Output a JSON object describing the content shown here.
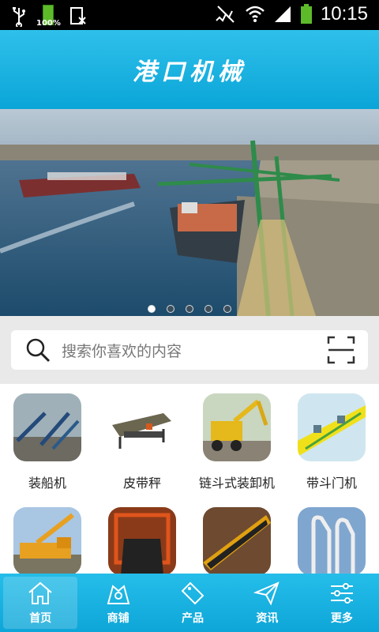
{
  "status_bar": {
    "battery_label": "100%",
    "time": "10:15"
  },
  "header": {
    "title": "港口机械"
  },
  "banner": {
    "slide_count": 5,
    "active_index": 0
  },
  "search": {
    "placeholder": "搜索你喜欢的内容"
  },
  "categories": [
    {
      "label": "装船机",
      "icon": "ship-loader-photo"
    },
    {
      "label": "皮带秤",
      "icon": "belt-scale-photo"
    },
    {
      "label": "链斗式装卸机",
      "icon": "bucket-chain-loader-photo"
    },
    {
      "label": "带斗门机",
      "icon": "hopper-portal-crane-photo"
    },
    {
      "label": "",
      "icon": "mobile-crane-photo"
    },
    {
      "label": "",
      "icon": "conveyor-belt-photo"
    },
    {
      "label": "",
      "icon": "belt-conveyor-photo"
    },
    {
      "label": "",
      "icon": "loading-arms-photo"
    }
  ],
  "tabs": [
    {
      "label": "首页",
      "icon": "home-icon"
    },
    {
      "label": "商铺",
      "icon": "shop-icon"
    },
    {
      "label": "产品",
      "icon": "sale-tag-icon"
    },
    {
      "label": "资讯",
      "icon": "paper-plane-icon"
    },
    {
      "label": "更多",
      "icon": "sliders-icon"
    }
  ],
  "colors": {
    "accent": "#0ea6d8",
    "header_top": "#2fc0ea"
  }
}
